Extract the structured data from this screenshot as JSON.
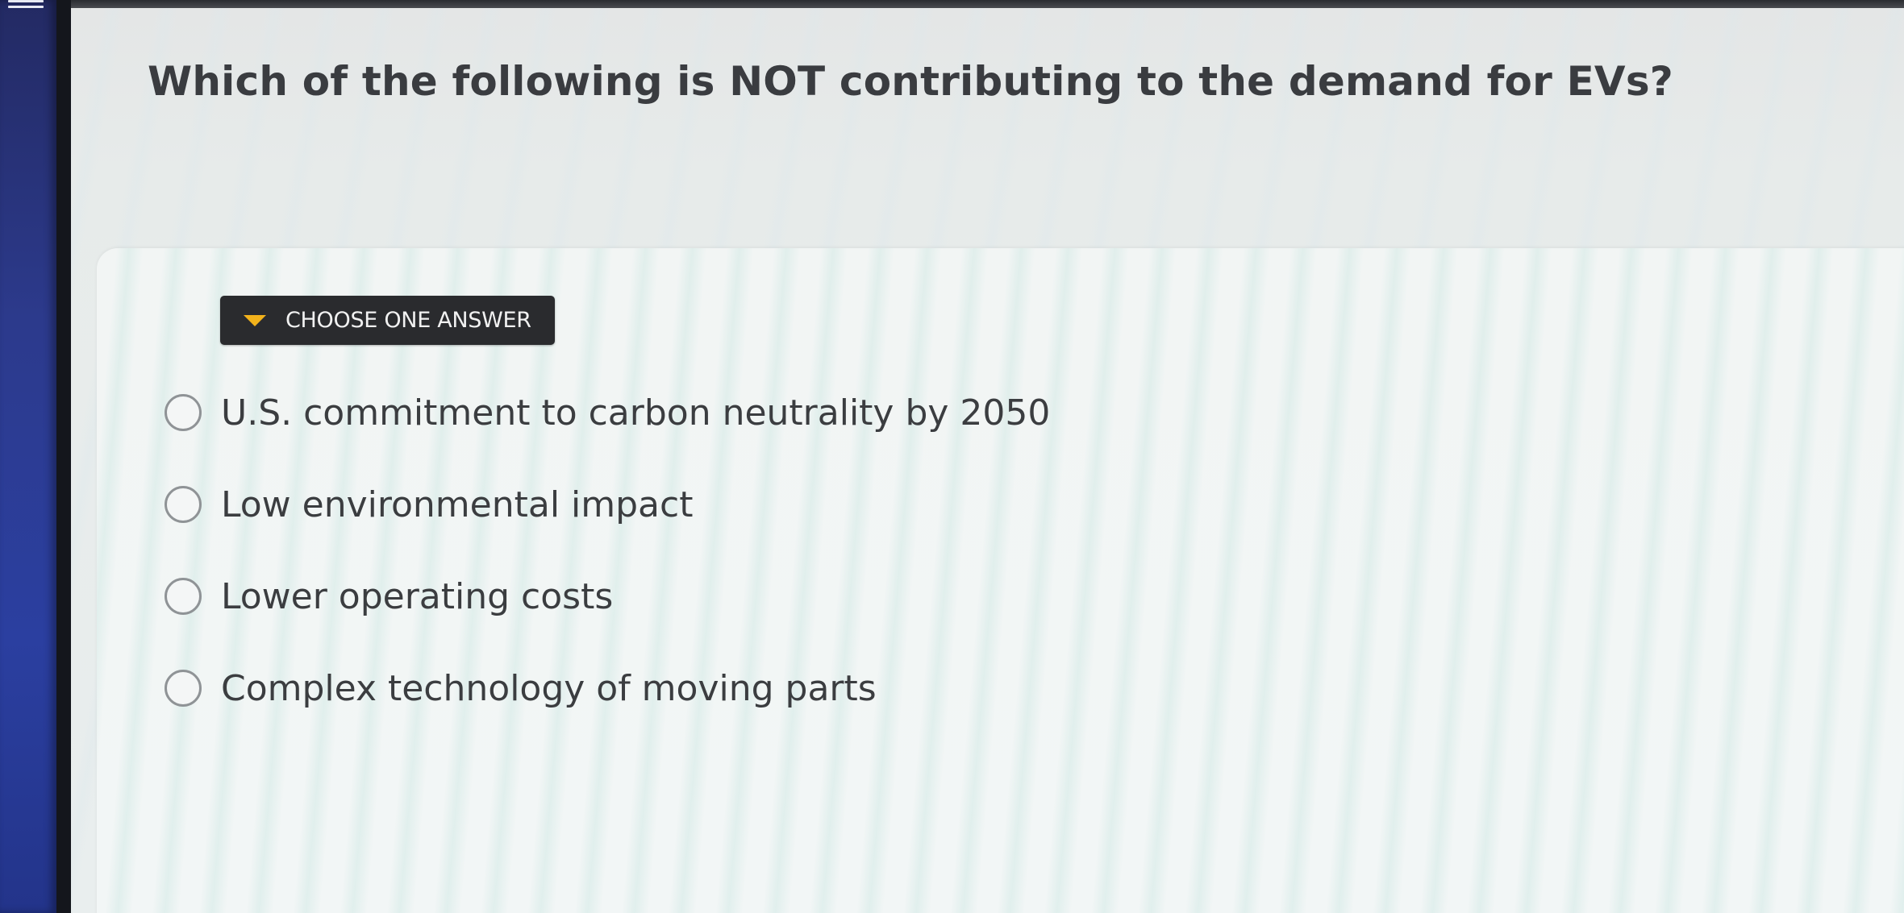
{
  "app": {
    "menu_icon": "hamburger-icon"
  },
  "question": {
    "text": "Which of the following is NOT contributing to the demand for EVs?"
  },
  "answer_section": {
    "header_label": "CHOOSE ONE ANSWER",
    "header_icon": "caret-down-icon",
    "accent_color": "#f2b21b",
    "options": [
      {
        "label": "U.S. commitment to carbon neutrality by 2050",
        "selected": false
      },
      {
        "label": "Low environmental impact",
        "selected": false
      },
      {
        "label": "Lower operating costs",
        "selected": false
      },
      {
        "label": "Complex technology of moving parts",
        "selected": false
      }
    ]
  }
}
